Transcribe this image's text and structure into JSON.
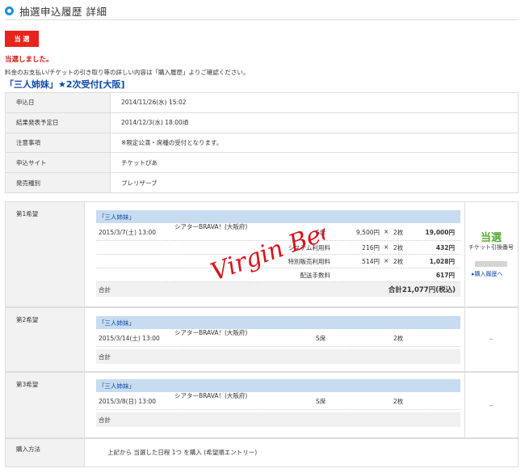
{
  "header": {
    "title": "抽選申込履歴 詳細"
  },
  "status": {
    "badge": "当 選",
    "message": "当選しました。",
    "note": "料金のお支払い/チケットの引き取り等の詳しい内容は「購入履歴」よりご確認ください。"
  },
  "event": {
    "title": "「三人姉妹」★2次受付[大阪]"
  },
  "info": [
    {
      "label": "申込日",
      "value": "2014/11/26(水) 15:02"
    },
    {
      "label": "結果発表予定日",
      "value": "2014/12/3(水) 18:00頃"
    },
    {
      "label": "注意事項",
      "value": "※限定公演・席種の受付となります。"
    },
    {
      "label": "申込サイト",
      "value": "チケットぴあ"
    },
    {
      "label": "発売種別",
      "value": "プレリザーブ"
    }
  ],
  "choices": {
    "first": {
      "label": "第1希望",
      "title": "「三人姉妹」",
      "date": "2015/3/7(土) 13:00",
      "venue": "シアターBRAVA！(大阪府)",
      "seat": "S席",
      "price": "9,500円",
      "times": "×",
      "qty": "2枚",
      "subtotal": "19,000円",
      "fees": [
        {
          "name": "システム利用料",
          "price": "216円",
          "times": "×",
          "qty": "2枚",
          "subtotal": "432円"
        },
        {
          "name": "特別販売利用料",
          "price": "514円",
          "times": "×",
          "qty": "2枚",
          "subtotal": "1,028円"
        },
        {
          "name": "配送手数料",
          "price": "",
          "times": "",
          "qty": "",
          "subtotal": "617円"
        }
      ],
      "total_label": "合計",
      "total_value": "合計21,077円(税込)",
      "result": "当選",
      "ticket_label": "チケット引換番号",
      "link": "▸購入履歴へ"
    },
    "second": {
      "label": "第2希望",
      "title": "「三人姉妹」",
      "date": "2015/3/14(土) 13:00",
      "venue": "シアターBRAVA！(大阪府)",
      "seat": "S席",
      "qty": "2枚",
      "total_label": "合計",
      "result": "–"
    },
    "third": {
      "label": "第3希望",
      "title": "「三人姉妹」",
      "date": "2015/3/8(日) 13:00",
      "venue": "シアターBRAVA！(大阪府)",
      "seat": "S席",
      "qty": "2枚",
      "total_label": "合計",
      "result": "–"
    }
  },
  "method": {
    "label": "購入方法",
    "value": "上記から 当選した日程 1つ を購入 (希望順エントリー)"
  },
  "watermark": {
    "text": "Virgin Beat",
    "color": "#d8141c"
  }
}
